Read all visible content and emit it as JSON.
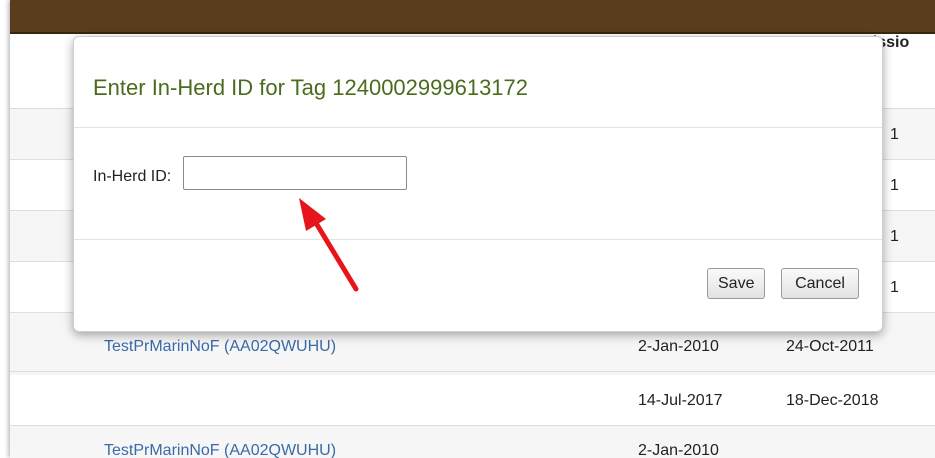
{
  "table": {
    "header_partial": "nissio",
    "rows": [
      {
        "name": "",
        "date1": "",
        "date2": "",
        "date3": "1"
      },
      {
        "name": "",
        "date1": "",
        "date2": "",
        "date3": "1"
      },
      {
        "name": "",
        "date1": "",
        "date2": "",
        "date3": "1"
      },
      {
        "name": "",
        "date1": "",
        "date2": "",
        "date3": "1"
      },
      {
        "name": "TestPrMarinNoF (AA02QWUHU)",
        "date1": "2-Jan-2010",
        "date2": "24-Oct-2011",
        "date3": ""
      },
      {
        "name": "",
        "date1": "14-Jul-2017",
        "date2": "18-Dec-2018",
        "date3": ""
      },
      {
        "name": "TestPrMarinNoF (AA02QWUHU)",
        "date1": "2-Jan-2010",
        "date2": "",
        "date3": ""
      }
    ]
  },
  "modal": {
    "title": "Enter In-Herd ID for Tag 1240002999613172",
    "field_label": "In-Herd ID:",
    "field_value": "",
    "save_label": "Save",
    "cancel_label": "Cancel"
  },
  "annotation": {
    "arrow_color": "#e8141b",
    "icon": "red-arrow-icon"
  },
  "colors": {
    "top_bar": "#5a3d1e",
    "title_green": "#4b6b1e",
    "link_blue": "#3a6aa8"
  }
}
